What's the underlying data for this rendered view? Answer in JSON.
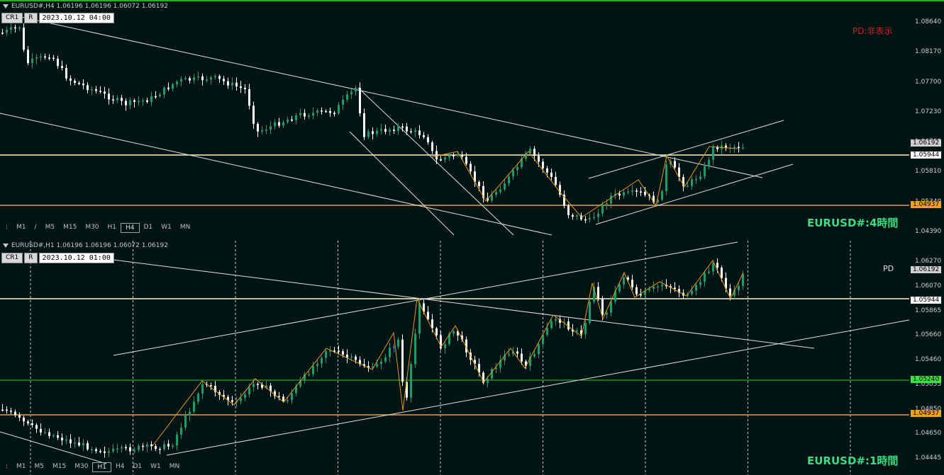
{
  "panel_h4": {
    "title": "EURUSD#,H4  1.06196 1.06196 1.06072 1.06192",
    "btn_cr1": "CR1",
    "btn_r": "R",
    "date": "2023.10.12 04:00",
    "pd_label": "PD:非表示",
    "big_label": "EURUSD#:4時間",
    "timeframes": [
      ":",
      "M1",
      "/",
      "M5",
      "M15",
      "M30",
      "H1",
      "H4",
      "D1",
      "W1",
      "MN"
    ],
    "active_tf": "H4",
    "axis_labels": [
      "1.08640",
      "1.08170",
      "1.07700",
      "1.07230",
      "1.06760",
      "1.05810",
      "1.05340",
      "1.04390"
    ],
    "price_tags": [
      {
        "value": "1.06192",
        "bg": "#d0d0d0"
      },
      {
        "value": "1.05944",
        "bg": "#ffffff"
      },
      {
        "value": "1.04937",
        "bg": "#f0a020"
      }
    ]
  },
  "panel_h1": {
    "title": "EURUSD#,H1  1.06196 1.06196 1.06072 1.06192",
    "btn_cr1": "CR1",
    "btn_r": "R",
    "date": "2023.10.12 01:00",
    "pd_label": "PD",
    "big_label": "EURUSD#:1時間",
    "timeframes": [
      ":",
      "M1",
      "M5",
      "M15",
      "M30",
      "H1",
      "H4",
      "D1",
      "W1",
      "MN"
    ],
    "active_tf": "H1",
    "axis_labels": [
      "1.06270",
      "1.06070",
      "1.05865",
      "1.05660",
      "1.05460",
      "1.05055",
      "1.04850",
      "1.04650",
      "1.04445"
    ],
    "price_tags": [
      {
        "value": "1.06192",
        "bg": "#d0d0d0"
      },
      {
        "value": "1.05944",
        "bg": "#ffffff"
      },
      {
        "value": "1.05240",
        "bg": "#40e040"
      },
      {
        "value": "1.04937",
        "bg": "#f0a020"
      }
    ]
  },
  "colors": {
    "bull": "#1f9a6a",
    "bear": "#ffffff",
    "zigzag": "#e8960a",
    "level_white": "#fff3c8",
    "level_orange": "#e8a040",
    "level_green": "#40c040"
  }
}
